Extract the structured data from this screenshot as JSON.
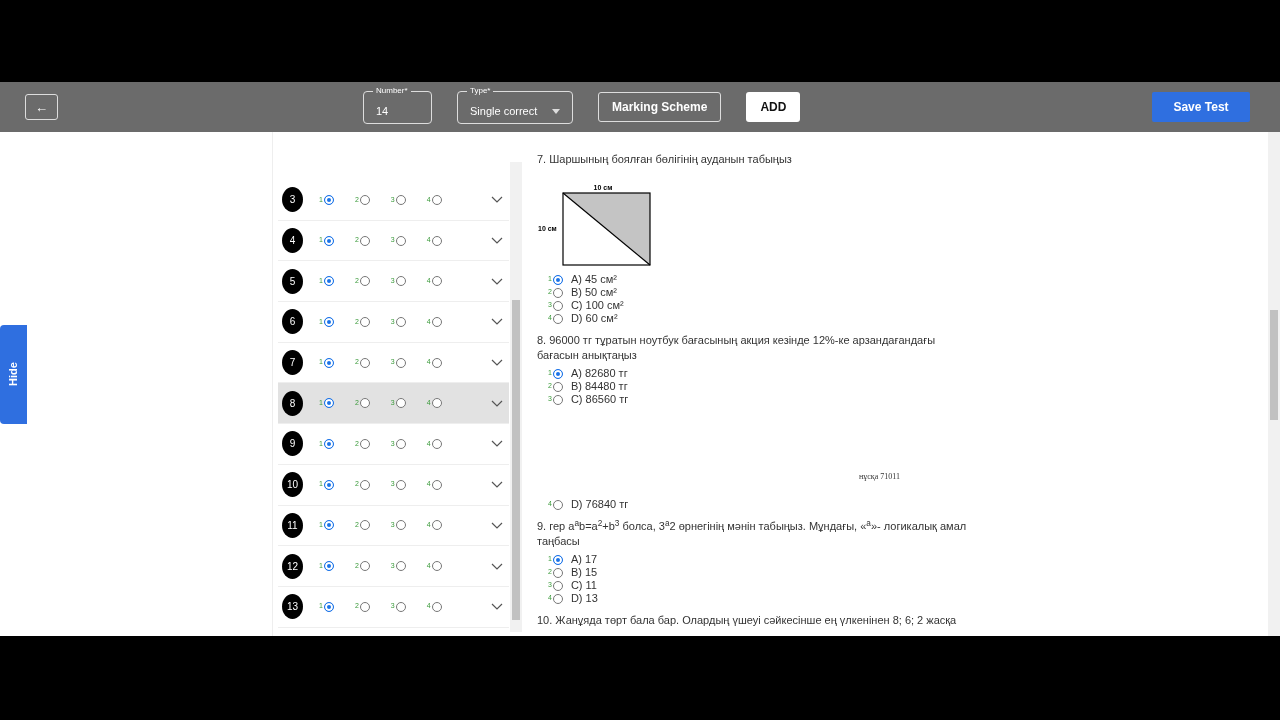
{
  "toolbar": {
    "back_button": "←",
    "number_field": {
      "label": "Number*",
      "value": "14"
    },
    "type_field": {
      "label": "Type*",
      "value": "Single correct"
    },
    "buttons": [
      {
        "label": "Marking Scheme",
        "kind": "outline"
      },
      {
        "label": "ADD",
        "kind": "light"
      }
    ],
    "save_button": "Save Test"
  },
  "side_tab": "Hide",
  "answer_rows": [
    {
      "number": "3",
      "highlighted": false,
      "options": [
        {
          "label": "1",
          "selected": true
        },
        {
          "label": "2",
          "selected": false
        },
        {
          "label": "3",
          "selected": false
        },
        {
          "label": "4",
          "selected": false
        }
      ]
    },
    {
      "number": "4",
      "highlighted": false,
      "options": [
        {
          "label": "1",
          "selected": true
        },
        {
          "label": "2",
          "selected": false
        },
        {
          "label": "3",
          "selected": false
        },
        {
          "label": "4",
          "selected": false
        }
      ]
    },
    {
      "number": "5",
      "highlighted": false,
      "options": [
        {
          "label": "1",
          "selected": true
        },
        {
          "label": "2",
          "selected": false
        },
        {
          "label": "3",
          "selected": false
        },
        {
          "label": "4",
          "selected": false
        }
      ]
    },
    {
      "number": "6",
      "highlighted": false,
      "options": [
        {
          "label": "1",
          "selected": true
        },
        {
          "label": "2",
          "selected": false
        },
        {
          "label": "3",
          "selected": false
        },
        {
          "label": "4",
          "selected": false
        }
      ]
    },
    {
      "number": "7",
      "highlighted": false,
      "options": [
        {
          "label": "1",
          "selected": true
        },
        {
          "label": "2",
          "selected": false
        },
        {
          "label": "3",
          "selected": false
        },
        {
          "label": "4",
          "selected": false
        }
      ]
    },
    {
      "number": "8",
      "highlighted": true,
      "options": [
        {
          "label": "1",
          "selected": true
        },
        {
          "label": "2",
          "selected": false
        },
        {
          "label": "3",
          "selected": false
        },
        {
          "label": "4",
          "selected": false
        }
      ]
    },
    {
      "number": "9",
      "highlighted": false,
      "options": [
        {
          "label": "1",
          "selected": true
        },
        {
          "label": "2",
          "selected": false
        },
        {
          "label": "3",
          "selected": false
        },
        {
          "label": "4",
          "selected": false
        }
      ]
    },
    {
      "number": "10",
      "highlighted": false,
      "options": [
        {
          "label": "1",
          "selected": true
        },
        {
          "label": "2",
          "selected": false
        },
        {
          "label": "3",
          "selected": false
        },
        {
          "label": "4",
          "selected": false
        }
      ]
    },
    {
      "number": "11",
      "highlighted": false,
      "options": [
        {
          "label": "1",
          "selected": true
        },
        {
          "label": "2",
          "selected": false
        },
        {
          "label": "3",
          "selected": false
        },
        {
          "label": "4",
          "selected": false
        }
      ]
    },
    {
      "number": "12",
      "highlighted": false,
      "options": [
        {
          "label": "1",
          "selected": true
        },
        {
          "label": "2",
          "selected": false
        },
        {
          "label": "3",
          "selected": false
        },
        {
          "label": "4",
          "selected": false
        }
      ]
    },
    {
      "number": "13",
      "highlighted": false,
      "options": [
        {
          "label": "1",
          "selected": true
        },
        {
          "label": "2",
          "selected": false
        },
        {
          "label": "3",
          "selected": false
        },
        {
          "label": "4",
          "selected": false
        }
      ]
    }
  ],
  "questions": [
    {
      "text": "7. Шаршының боялған бөлігінің ауданын табыңыз",
      "figure": {
        "kind": "square-diagram",
        "top_label": "10 см",
        "side_label": "10 см"
      },
      "options": [
        {
          "kind": "option",
          "label": "1",
          "text": "A) 45 см²",
          "selected": true
        },
        {
          "kind": "option",
          "label": "2",
          "text": "B) 50 см²",
          "selected": false
        },
        {
          "kind": "option",
          "label": "3",
          "text": "C) 100 см²",
          "selected": false
        },
        {
          "kind": "option",
          "label": "4",
          "text": "D) 60 см²",
          "selected": false
        }
      ]
    },
    {
      "text": "8. 96000 тг тұратын ноутбук бағасының акция кезінде 12%-ке арзандағандағы бағасын анықтаңыз",
      "options": [
        {
          "kind": "option",
          "label": "1",
          "text": "A) 82680 тг",
          "selected": true
        },
        {
          "kind": "option",
          "label": "2",
          "text": "B) 84480 тг",
          "selected": false
        },
        {
          "kind": "option",
          "label": "3",
          "text": "C) 86560 тг",
          "selected": false
        },
        {
          "kind": "note",
          "text": "нұсқа 71011"
        },
        {
          "kind": "option",
          "label": "4",
          "text": "D) 76840 тг",
          "selected": false
        }
      ]
    },
    {
      "text": "9. гер a$^{a}$b=a$^{2}$+b$^{3}$ болса, 3$^{a}$2 өрнегінің мәнін табыңыз. Мұндағы, «$^{a}$»- логикалық амал таңбасы",
      "options": [
        {
          "kind": "option",
          "label": "1",
          "text": "A) 17",
          "selected": true
        },
        {
          "kind": "option",
          "label": "2",
          "text": "B) 15",
          "selected": false
        },
        {
          "kind": "option",
          "label": "3",
          "text": "C) 11",
          "selected": false
        },
        {
          "kind": "option",
          "label": "4",
          "text": "D) 13",
          "selected": false
        }
      ]
    },
    {
      "text": "10. Жанұяда төрт бала бар. Олардың үшеуі сәйкесінше ең үлкенінен 8; 6; 2 жасқа"
    }
  ]
}
